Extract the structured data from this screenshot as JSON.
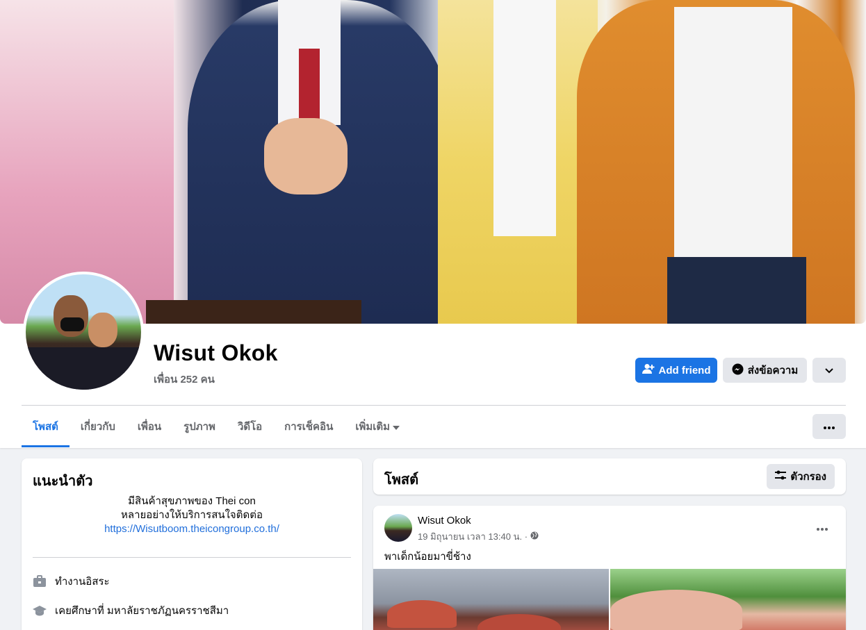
{
  "profile": {
    "name": "Wisut Okok",
    "friends": "เพื่อน 252 คน"
  },
  "actions": {
    "add_friend": "Add friend",
    "message": "ส่งข้อความ"
  },
  "tabs": [
    {
      "label": "โพสต์",
      "active": true
    },
    {
      "label": "เกี่ยวกับ"
    },
    {
      "label": "เพื่อน"
    },
    {
      "label": "รูปภาพ"
    },
    {
      "label": "วิดีโอ"
    },
    {
      "label": "การเช็คอิน"
    },
    {
      "label": "เพิ่มเติม"
    }
  ],
  "intro": {
    "title": "แนะนำตัว",
    "bio_line1": "มีสินค้าสุขภาพของ Thei con",
    "bio_line2": "หลายอย่างให้บริการสนใจติดต่อ",
    "bio_link": "https://Wisutboom.theicongroup.co.th/",
    "work": "ทำงานอิสระ",
    "education": "เคยศึกษาที่ มหาลัยราชภัฏนครราชสีมา"
  },
  "posts": {
    "title": "โพสต์",
    "filter_label": "ตัวกรอง",
    "items": [
      {
        "author": "Wisut Okok",
        "timestamp": "19 มิถุนายน เวลา 13:40 น. ·",
        "text": "พาเด็กน้อยมาขี่ช้าง"
      }
    ]
  },
  "colors": {
    "primary": "#1b74e4",
    "secondary_bg": "#e4e6eb",
    "muted_text": "#65676b",
    "page_bg": "#f0f2f5"
  },
  "icons": {
    "add_friend": "add-person-icon",
    "message": "messenger-icon",
    "dropdown": "chevron-down-icon",
    "more": "more-dots-icon",
    "work": "briefcase-icon",
    "education": "graduation-cap-icon",
    "filter": "filter-sliders-icon",
    "privacy": "globe-icon"
  }
}
